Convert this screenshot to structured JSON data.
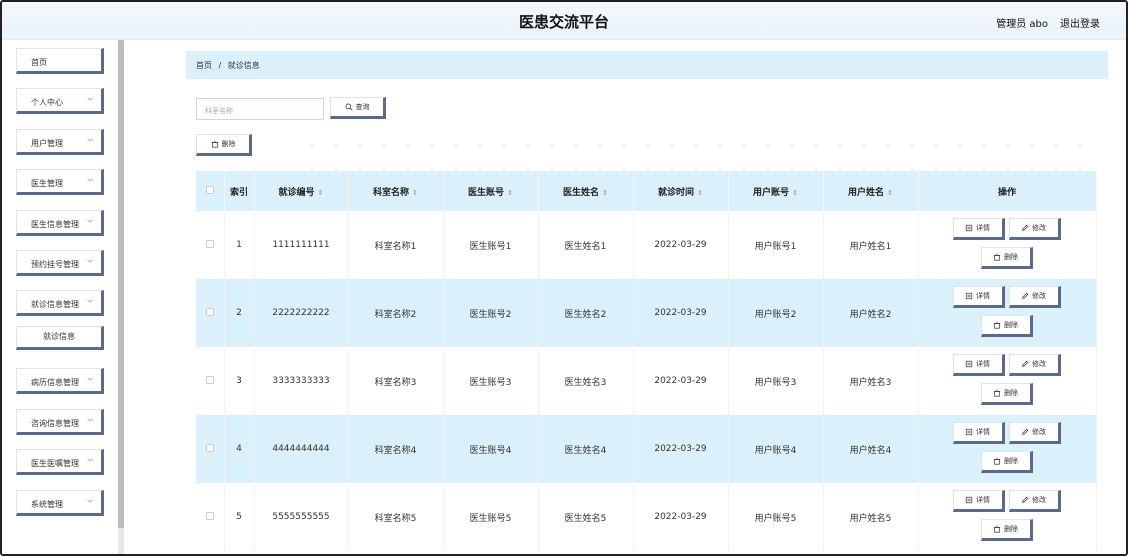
{
  "header": {
    "title": "医患交流平台",
    "user": "管理员 abo",
    "logout": "退出登录"
  },
  "sidebar": {
    "items": [
      {
        "label": "首页",
        "has_chevron": false
      },
      {
        "label": "个人中心",
        "has_chevron": true
      },
      {
        "label": "用户管理",
        "has_chevron": true
      },
      {
        "label": "医生管理",
        "has_chevron": true
      },
      {
        "label": "医生信息管理",
        "has_chevron": true
      },
      {
        "label": "预约挂号管理",
        "has_chevron": true
      },
      {
        "label": "就诊信息管理",
        "has_chevron": true
      },
      {
        "label": "就诊信息",
        "sub": true
      },
      {
        "label": "病历信息管理",
        "has_chevron": true
      },
      {
        "label": "咨询信息管理",
        "has_chevron": true
      },
      {
        "label": "医生医嘱管理",
        "has_chevron": true
      },
      {
        "label": "系统管理",
        "has_chevron": true
      }
    ]
  },
  "breadcrumb": {
    "home": "首页",
    "separator": "/",
    "current": "就诊信息"
  },
  "search": {
    "placeholder": "科室名称",
    "button": "查询"
  },
  "toolbar": {
    "delete": "删除"
  },
  "table": {
    "headers": {
      "index": "索引",
      "visit_no": "就诊编号",
      "dept": "科室名称",
      "doctor_account": "医生账号",
      "doctor_name": "医生姓名",
      "visit_time": "就诊时间",
      "user_account": "用户账号",
      "user_name": "用户姓名",
      "actions": "操作"
    },
    "rows": [
      {
        "index": "1",
        "visit_no": "1111111111",
        "dept": "科室名称1",
        "doctor_account": "医生账号1",
        "doctor_name": "医生姓名1",
        "visit_time": "2022-03-29",
        "user_account": "用户账号1",
        "user_name": "用户姓名1"
      },
      {
        "index": "2",
        "visit_no": "2222222222",
        "dept": "科室名称2",
        "doctor_account": "医生账号2",
        "doctor_name": "医生姓名2",
        "visit_time": "2022-03-29",
        "user_account": "用户账号2",
        "user_name": "用户姓名2"
      },
      {
        "index": "3",
        "visit_no": "3333333333",
        "dept": "科室名称3",
        "doctor_account": "医生账号3",
        "doctor_name": "医生姓名3",
        "visit_time": "2022-03-29",
        "user_account": "用户账号3",
        "user_name": "用户姓名3"
      },
      {
        "index": "4",
        "visit_no": "4444444444",
        "dept": "科室名称4",
        "doctor_account": "医生账号4",
        "doctor_name": "医生姓名4",
        "visit_time": "2022-03-29",
        "user_account": "用户账号4",
        "user_name": "用户姓名4"
      },
      {
        "index": "5",
        "visit_no": "5555555555",
        "dept": "科室名称5",
        "doctor_account": "医生账号5",
        "doctor_name": "医生姓名5",
        "visit_time": "2022-03-29",
        "user_account": "用户账号5",
        "user_name": "用户姓名5"
      }
    ],
    "row_actions": {
      "detail": "详情",
      "edit": "修改",
      "delete": "删除"
    }
  },
  "colors": {
    "accent_bg": "#daf0fb",
    "button_shadow": "#5b6a8a"
  },
  "icons": [
    "search-icon",
    "delete-icon",
    "detail-icon",
    "edit-icon",
    "chevron-down-icon"
  ]
}
